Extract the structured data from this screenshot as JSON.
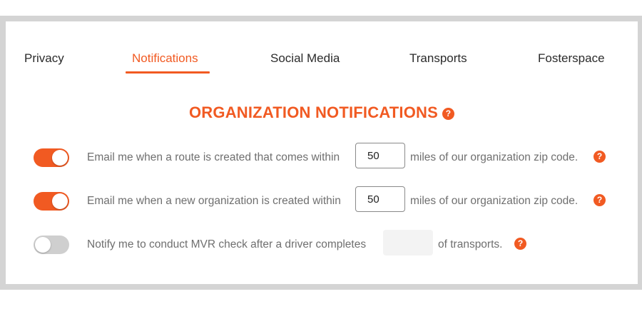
{
  "tabs": [
    {
      "label": "Privacy",
      "active": false
    },
    {
      "label": "Notifications",
      "active": true
    },
    {
      "label": "Social Media",
      "active": false
    },
    {
      "label": "Transports",
      "active": false
    },
    {
      "label": "Fosterspace",
      "active": false
    }
  ],
  "section": {
    "title": "ORGANIZATION NOTIFICATIONS",
    "help_icon": "?"
  },
  "settings": [
    {
      "enabled": true,
      "label_before": "Email me when a route is created that comes within",
      "value": "50",
      "label_after": "miles of our organization zip code.",
      "help_icon": "?"
    },
    {
      "enabled": true,
      "label_before": "Email me when a new organization is created within",
      "value": "50",
      "label_after": "miles of our organization zip code.",
      "help_icon": "?"
    },
    {
      "enabled": false,
      "label_before": "Notify me to conduct MVR check after a driver completes",
      "value": "",
      "label_after": "of transports.",
      "help_icon": "?"
    }
  ],
  "colors": {
    "accent": "#f15a22",
    "toggle_off": "#cfcfcf",
    "text_muted": "#6f6f6f"
  }
}
